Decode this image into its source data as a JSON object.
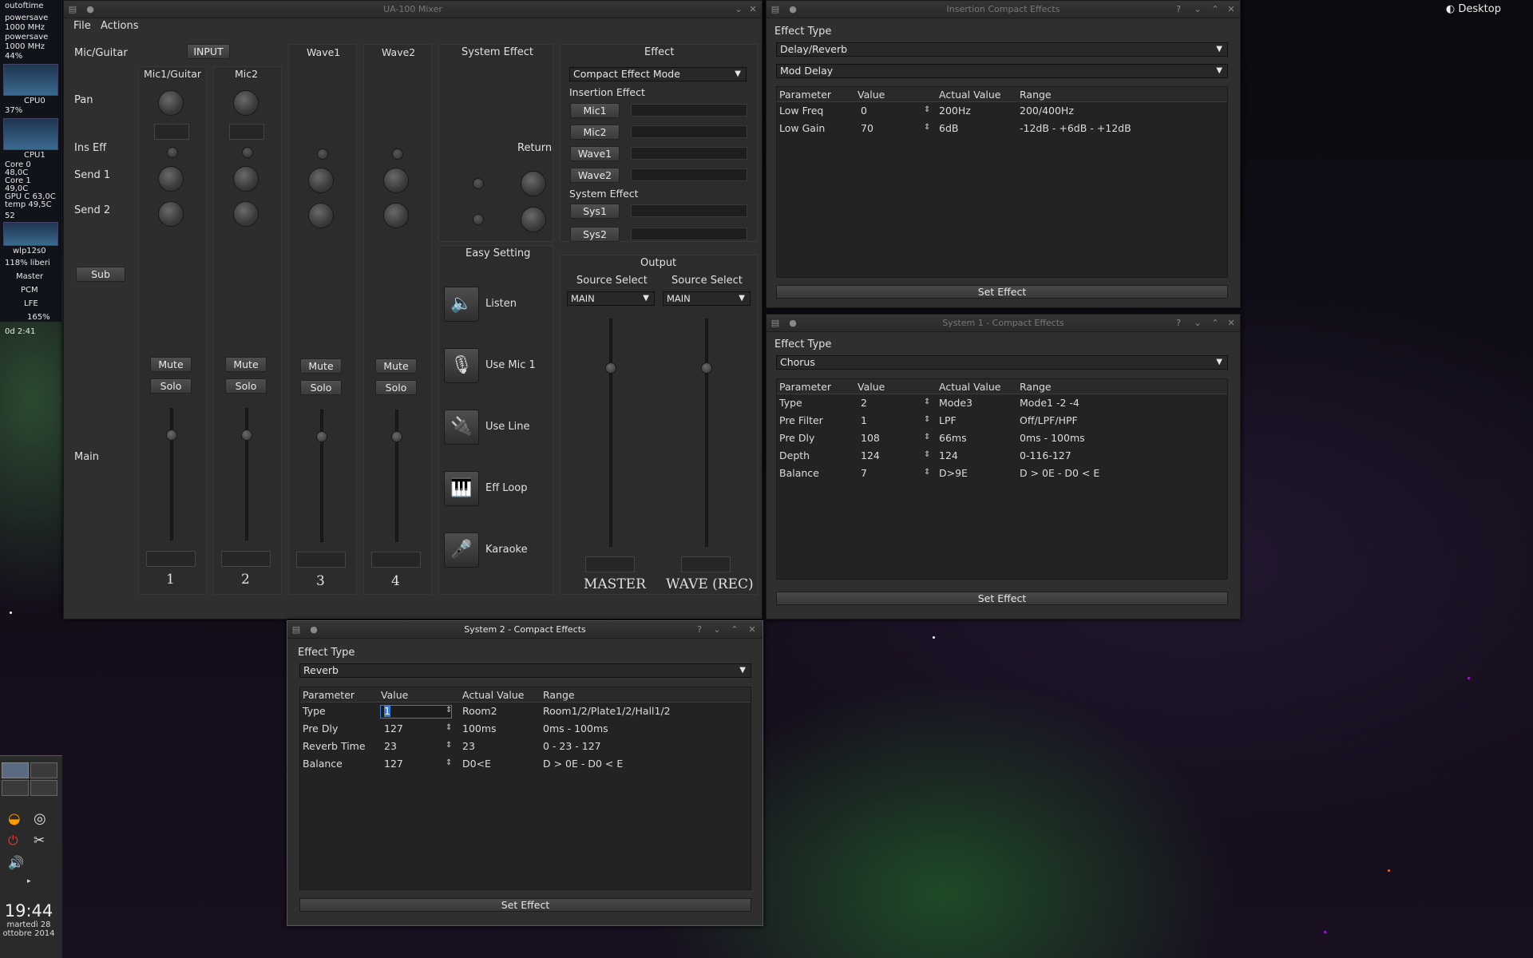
{
  "desktop": {
    "label": "Desktop"
  },
  "conky": {
    "lines": [
      "outoftime",
      "powersave",
      "1000 MHz",
      "powersave",
      "1000 MHz",
      "44%",
      "CPU0",
      "37%",
      "CPU1",
      "Core 0  48,0C",
      "Core 1  49,0C",
      "GPU C  63,0C",
      "temp    49,5C",
      "52",
      "wlp12s0",
      "118% liberi",
      "Master",
      "PCM",
      "LFE",
      "165%",
      "0d  2:41"
    ]
  },
  "panel": {
    "time": "19:44",
    "date1": "martedì 28",
    "date2": "ottobre 2014"
  },
  "mixer": {
    "title": "UA-100 Mixer",
    "menu": [
      "File",
      "Actions"
    ],
    "rows": {
      "mic_guitar": "Mic/Guitar",
      "pan": "Pan",
      "ins_eff": "Ins Eff",
      "send1": "Send 1",
      "send2": "Send 2",
      "sub": "Sub",
      "main": "Main"
    },
    "input_btn": "INPUT",
    "channels": [
      {
        "name": "Mic1/Guitar",
        "num": "1"
      },
      {
        "name": "Mic2",
        "num": "2"
      },
      {
        "name": "Wave1",
        "num": "3"
      },
      {
        "name": "Wave2",
        "num": "4"
      }
    ],
    "mute": "Mute",
    "solo": "Solo",
    "system_effect": {
      "title": "System Effect",
      "return": "Return"
    },
    "effect": {
      "title": "Effect",
      "mode": "Compact Effect Mode",
      "insertion": "Insertion Effect",
      "ins_buttons": [
        "Mic1",
        "Mic2",
        "Wave1",
        "Wave2"
      ],
      "system": "System Effect",
      "sys_buttons": [
        "Sys1",
        "Sys2"
      ]
    },
    "easy": {
      "title": "Easy Setting",
      "items": [
        {
          "label": "Listen",
          "icon": "speaker-icon"
        },
        {
          "label": "Use Mic 1",
          "icon": "microphone-icon"
        },
        {
          "label": "Use Line",
          "icon": "line-cable-icon"
        },
        {
          "label": "Eff Loop",
          "icon": "keyboard-icon"
        },
        {
          "label": "Karaoke",
          "icon": "karaoke-mic-icon"
        }
      ]
    },
    "output": {
      "title": "Output",
      "source_select": "Source Select",
      "source1": "MAIN",
      "source2": "MAIN",
      "master": "MASTER",
      "wave": "WAVE (REC)"
    }
  },
  "insertion_win": {
    "title": "Insertion Compact Effects",
    "effect_type_label": "Effect Type",
    "effect_type": "Delay/Reverb",
    "sub_type": "Mod Delay",
    "headers": [
      "Parameter",
      "Value",
      "Actual Value",
      "Range"
    ],
    "rows": [
      [
        "Low Freq",
        "0",
        "200Hz",
        "200/400Hz"
      ],
      [
        "Low Gain",
        "70",
        "6dB",
        "-12dB - +6dB - +12dB"
      ]
    ],
    "set": "Set Effect"
  },
  "sys1_win": {
    "title": "System 1 - Compact Effects",
    "effect_type_label": "Effect Type",
    "effect_type": "Chorus",
    "headers": [
      "Parameter",
      "Value",
      "Actual Value",
      "Range"
    ],
    "rows": [
      [
        "Type",
        "2",
        "Mode3",
        "Mode1 -2 -4"
      ],
      [
        "Pre Filter",
        "1",
        "LPF",
        "Off/LPF/HPF"
      ],
      [
        "Pre Dly",
        "108",
        "66ms",
        "0ms - 100ms"
      ],
      [
        "Depth",
        "124",
        "124",
        "0-116-127"
      ],
      [
        "Balance",
        "7",
        "D>9E",
        "D > 0E - D0 < E"
      ]
    ],
    "set": "Set Effect"
  },
  "sys2_win": {
    "title": "System 2 - Compact Effects",
    "effect_type_label": "Effect Type",
    "effect_type": "Reverb",
    "headers": [
      "Parameter",
      "Value",
      "Actual Value",
      "Range"
    ],
    "rows": [
      [
        "Type",
        "1",
        "Room2",
        "Room1/2/Plate1/2/Hall1/2"
      ],
      [
        "Pre Dly",
        "127",
        "100ms",
        "0ms - 100ms"
      ],
      [
        "Reverb Time",
        "23",
        "23",
        "0 - 23 - 127"
      ],
      [
        "Balance",
        "127",
        "D0<E",
        "D > 0E - D0 < E"
      ]
    ],
    "set": "Set Effect"
  }
}
